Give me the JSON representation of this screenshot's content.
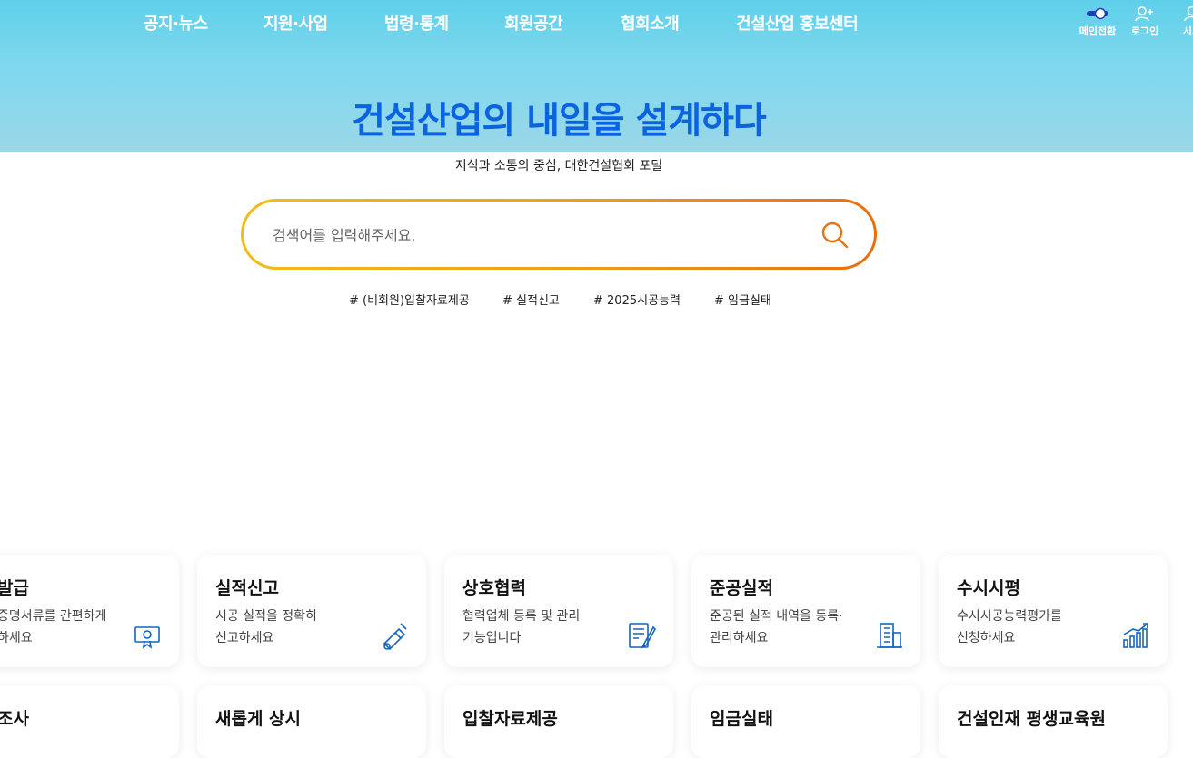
{
  "gnb": {
    "items": [
      "공지·뉴스",
      "지원·사업",
      "법령·통계",
      "회원공간",
      "협회소개",
      "건설산업 홍보센터"
    ]
  },
  "util": {
    "main_switch": "메인전환",
    "login": "로그인",
    "sitemap": "시의"
  },
  "hero": {
    "headline": "건설산업의 내일을 설계하다",
    "subline": "지식과 소통의 중심, 대한건설협회 포털"
  },
  "search": {
    "placeholder": "검색어를 입력해주세요."
  },
  "tags": [
    "# (비회원)입찰자료제공",
    "# 실적신고",
    "# 2025시공능력",
    "# 임금실태"
  ],
  "cards_row1": [
    {
      "title": "발급",
      "desc": "증명서류를 간편하게\n하세요",
      "icon": "certificate-icon"
    },
    {
      "title": "실적신고",
      "desc": "시공 실적을 정확히\n신고하세요",
      "icon": "scroll-pen-icon"
    },
    {
      "title": "상호협력",
      "desc": "협력업체 등록 및 관리\n기능입니다",
      "icon": "document-pen-icon"
    },
    {
      "title": "준공실적",
      "desc": "준공된 실적 내역을 등록·\n관리하세요",
      "icon": "building-icon"
    },
    {
      "title": "수시시평",
      "desc": "수시시공능력평가를\n신청하세요",
      "icon": "growth-chart-icon"
    }
  ],
  "cards_row2": [
    {
      "title": "조사"
    },
    {
      "title": "새롭게 상시"
    },
    {
      "title": "입찰자료제공"
    },
    {
      "title": "임금실태"
    },
    {
      "title": "건설인재 평생교육원"
    }
  ],
  "colors": {
    "headline": "#0b63e0",
    "hero_top": "#5fd0ea",
    "search_border_start": "#f2bc18",
    "search_border_end": "#e6700e",
    "icon_blue": "#1565c0"
  }
}
